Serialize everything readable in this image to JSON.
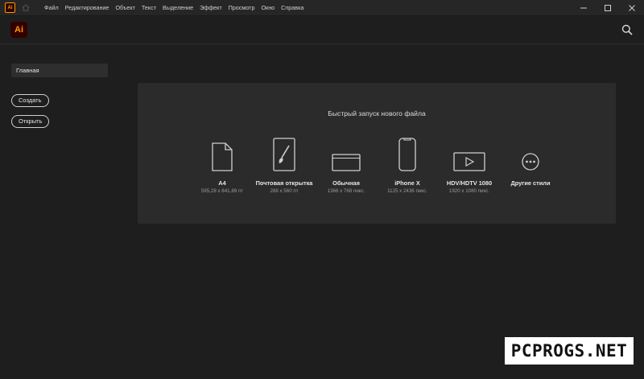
{
  "titlebar": {
    "menu": [
      "Файл",
      "Редактирование",
      "Объект",
      "Текст",
      "Выделение",
      "Эффект",
      "Просмотр",
      "Окно",
      "Справка"
    ]
  },
  "app": {
    "logo_text": "Ai"
  },
  "sidebar": {
    "home_label": "Главная",
    "create_label": "Создать",
    "open_label": "Открыть"
  },
  "quick_start": {
    "title": "Быстрый запуск нового файла",
    "presets": [
      {
        "name": "A4",
        "dims": "595,28 x 841,89 пт",
        "icon": "document-icon"
      },
      {
        "name": "Почтовая открытка",
        "dims": "288 x 560 пт",
        "icon": "postcard-brush-icon"
      },
      {
        "name": "Обычная",
        "dims": "1366 x 768 пикс.",
        "icon": "web-browser-icon"
      },
      {
        "name": "iPhone X",
        "dims": "1125 x 2436 пикс.",
        "icon": "phone-icon"
      },
      {
        "name": "HDV/HDTV 1080",
        "dims": "1920 x 1080 пикс.",
        "icon": "video-play-icon"
      },
      {
        "name": "Другие стили",
        "dims": "",
        "icon": "more-dots-icon"
      }
    ]
  },
  "watermark": {
    "text": "PCPROGS.NET"
  },
  "colors": {
    "accent": "#ff9a00",
    "logo_bg": "#330000",
    "panel_bg": "#2b2b2b",
    "bg": "#1e1e1e"
  }
}
